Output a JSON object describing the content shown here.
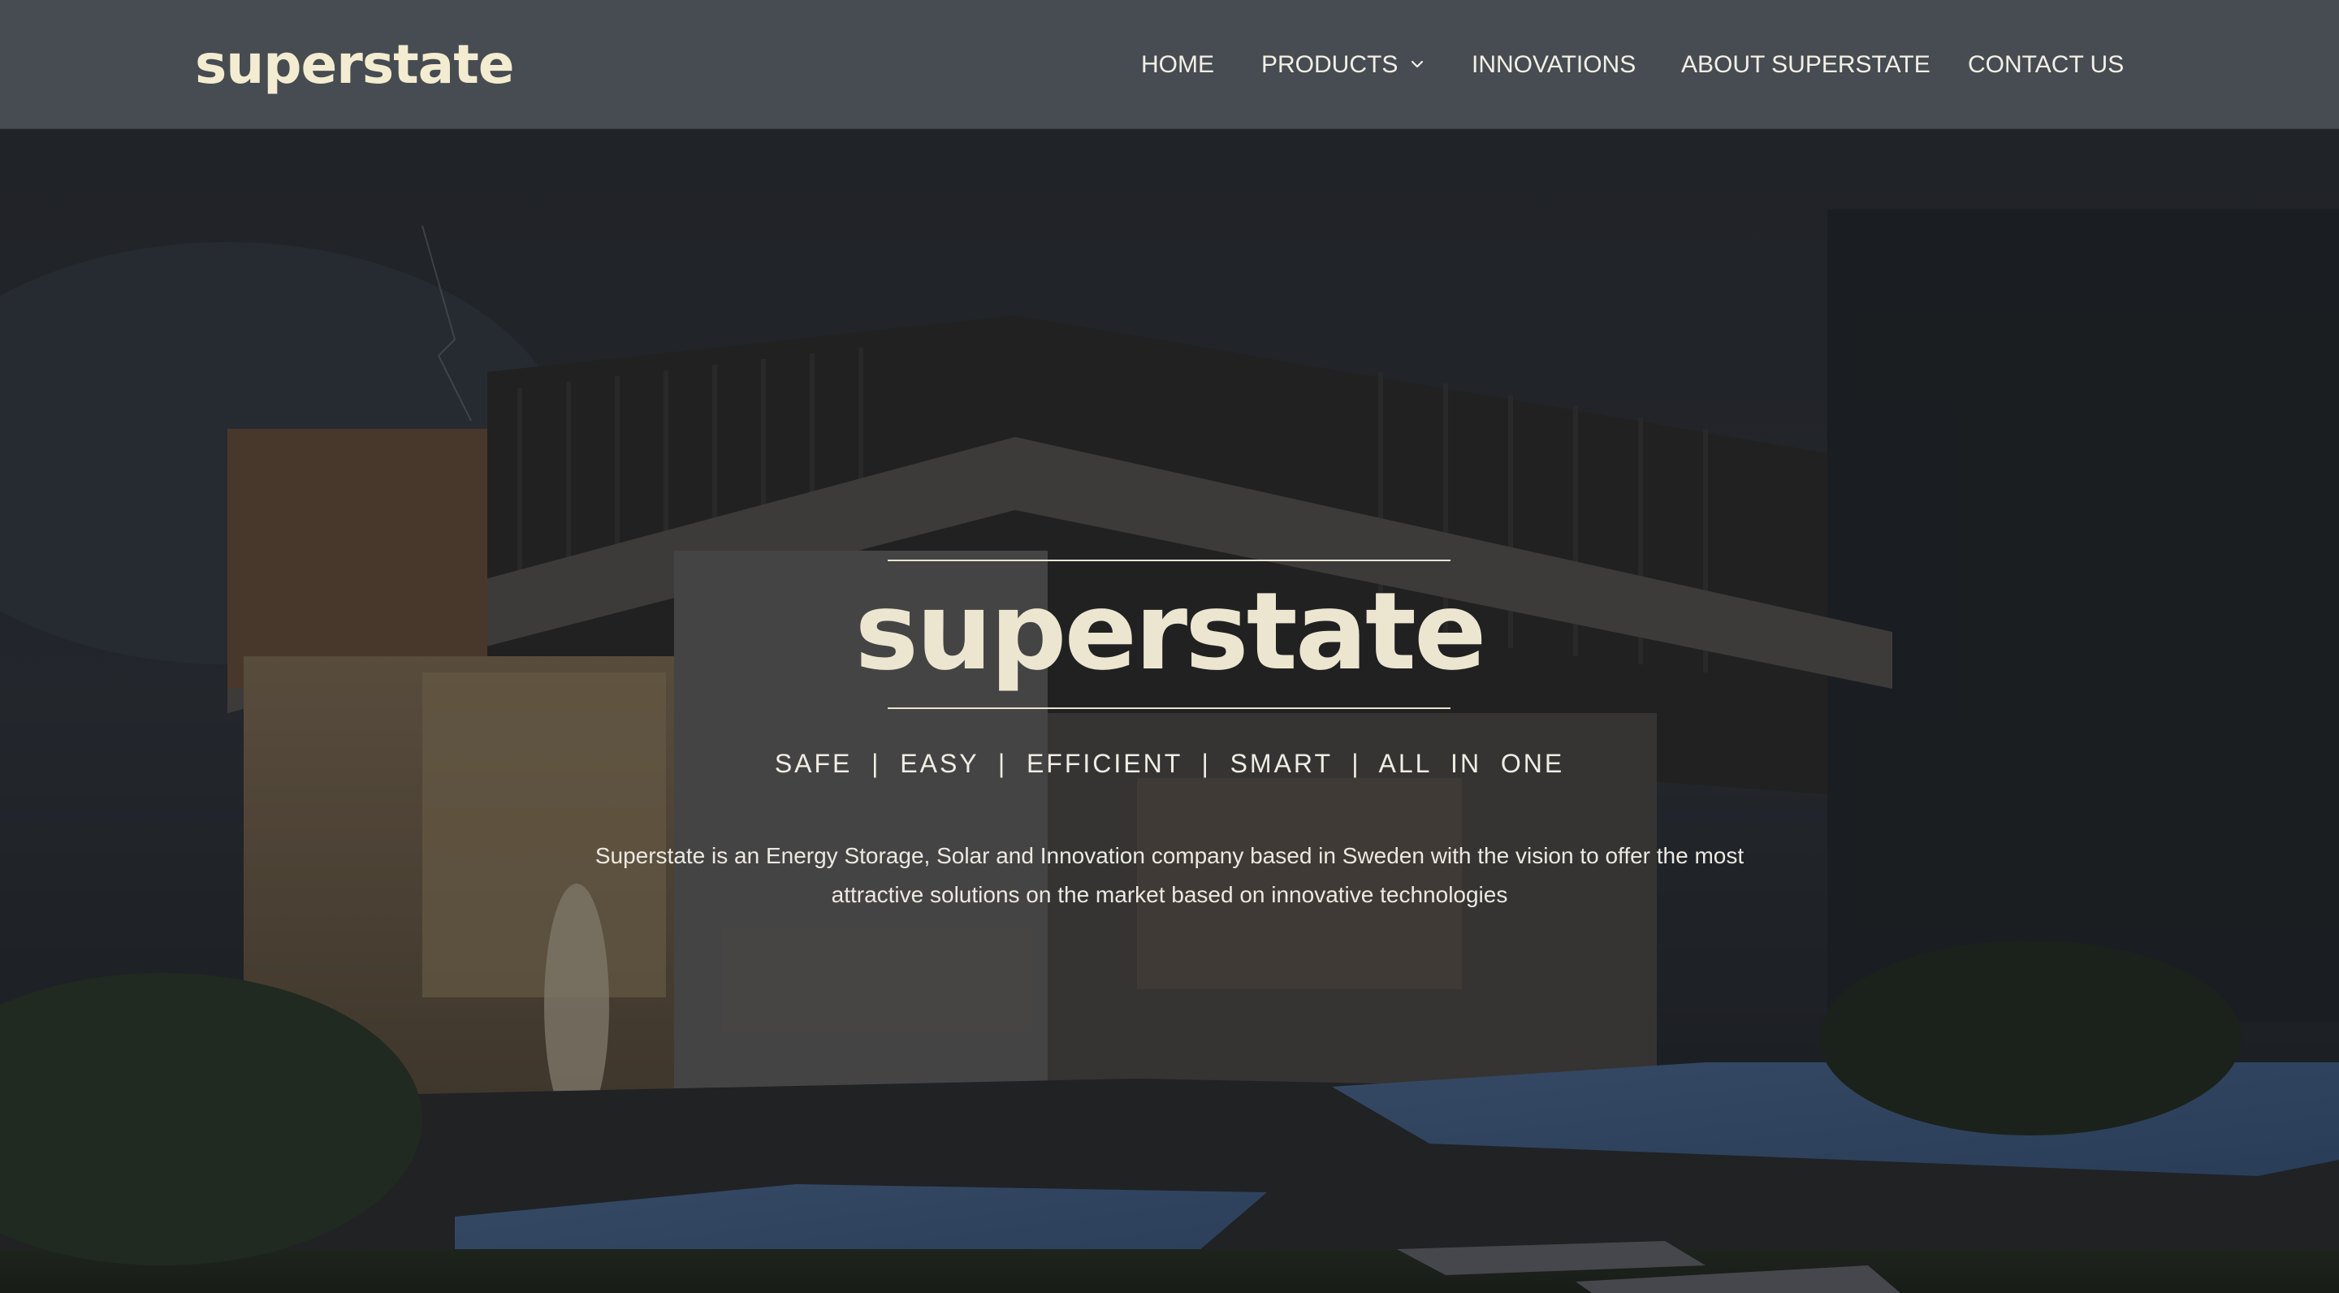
{
  "header": {
    "logo": "superstate",
    "nav": [
      {
        "label": "HOME"
      },
      {
        "label": "PRODUCTS",
        "has_dropdown": true
      },
      {
        "label": "INNOVATIONS"
      },
      {
        "label": "ABOUT SUPERSTATE"
      },
      {
        "label": "CONTACT US"
      }
    ]
  },
  "hero": {
    "title": "superstate",
    "tagline": "SAFE  |  EASY  |  EFFICIENT  |  SMART  |  ALL  IN  ONE",
    "description": "Superstate is an Energy Storage, Solar and Innovation company based in Sweden with the vision to offer the most attractive solutions on the market based on innovative technologies"
  },
  "colors": {
    "header_bg": "#464c51",
    "logo": "#f3ecd0",
    "hero_text": "#ece6d1"
  },
  "icons": {
    "dropdown": "chevron-down-icon"
  }
}
